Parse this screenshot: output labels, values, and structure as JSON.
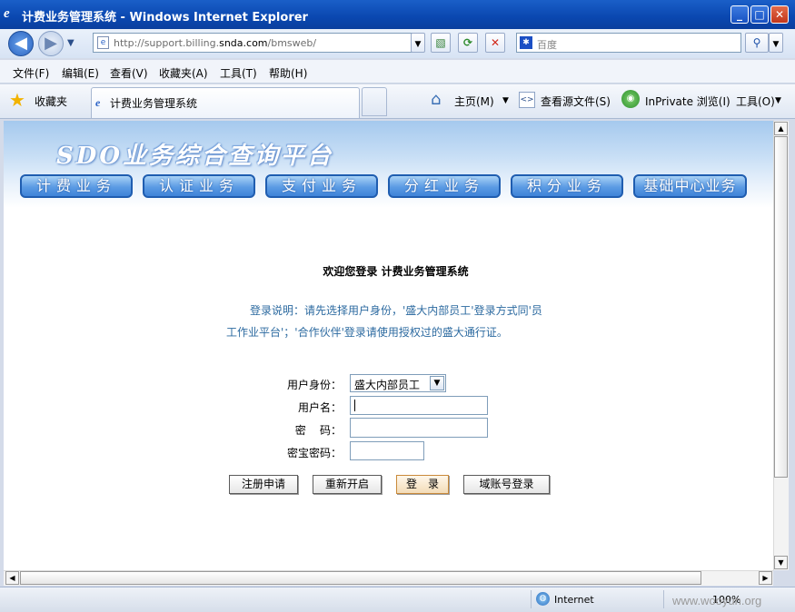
{
  "window": {
    "title": "计费业务管理系统 - Windows Internet Explorer",
    "minimize": "_",
    "maximize": "□",
    "close": "✕"
  },
  "address": {
    "url_prefix": "http://support.billing.",
    "url_domain": "snda.com",
    "url_suffix": "/bmsweb/"
  },
  "search": {
    "placeholder": "百度"
  },
  "menu": [
    "文件(F)",
    "编辑(E)",
    "查看(V)",
    "收藏夹(A)",
    "工具(T)",
    "帮助(H)"
  ],
  "favorites": {
    "label": "收藏夹",
    "tab_title": "计费业务管理系统"
  },
  "commands": {
    "home": "主页(M)",
    "view_source": "查看源文件(S)",
    "inprivate": "InPrivate 浏览(I)",
    "tools": "工具(O)"
  },
  "banner": {
    "title": "SDO业务综合查询平台",
    "tabs": [
      "计费业务",
      "认证业务",
      "支付业务",
      "分红业务",
      "积分业务",
      "基础中心业务"
    ]
  },
  "login": {
    "welcome": "欢迎您登录 计费业务管理系统",
    "instructions": "登录说明：请先选择用户身份，'盛大内部员工'登录方式同'员工作业平台'；'合作伙伴'登录请使用授权过的盛大通行证。",
    "identity_label": "用户身份：",
    "identity_value": "盛大内部员工",
    "username_label": "用户名：",
    "password_label": "密    码：",
    "token_label": "密宝密码：",
    "buttons": {
      "register": "注册申请",
      "restart": "重新开启",
      "login": "登　录",
      "domain_login": "域账号登录"
    }
  },
  "status": {
    "zone": "Internet",
    "zoom": "100%",
    "watermark": "www.wooyun.org"
  },
  "icons": [
    "ie-logo-icon",
    "back-icon",
    "forward-icon",
    "dropdown-icon",
    "page-icon",
    "compat-icon",
    "refresh-icon",
    "stop-icon",
    "baidu-icon",
    "search-icon",
    "star-icon",
    "home-icon",
    "source-icon",
    "inprivate-icon",
    "globe-icon"
  ]
}
